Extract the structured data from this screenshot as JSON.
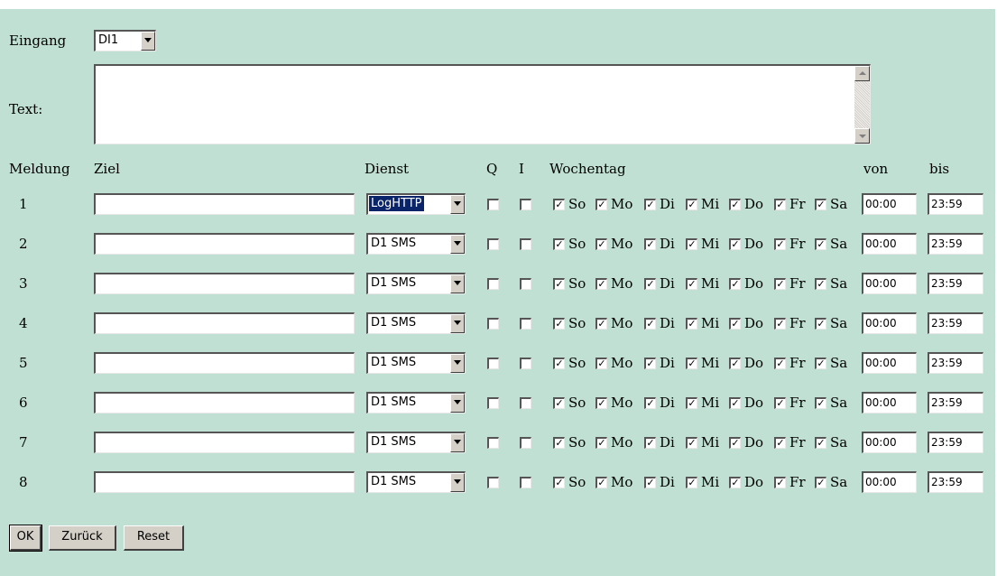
{
  "form": {
    "eingang_label": "Eingang",
    "eingang_value": "DI1",
    "text_label": "Text:",
    "text_value": ""
  },
  "columns": {
    "meldung": "Meldung",
    "ziel": "Ziel",
    "dienst": "Dienst",
    "q": "Q",
    "i": "I",
    "wochentag": "Wochentag",
    "von": "von",
    "bis": "bis"
  },
  "weekdays": [
    "So",
    "Mo",
    "Di",
    "Mi",
    "Do",
    "Fr",
    "Sa"
  ],
  "rows": [
    {
      "nr": "1",
      "ziel": "",
      "dienst": "LogHTTP",
      "q": false,
      "i": false,
      "days": [
        true,
        true,
        true,
        true,
        true,
        true,
        true
      ],
      "von": "00:00",
      "bis": "23:59"
    },
    {
      "nr": "2",
      "ziel": "",
      "dienst": "D1 SMS",
      "q": false,
      "i": false,
      "days": [
        true,
        true,
        true,
        true,
        true,
        true,
        true
      ],
      "von": "00:00",
      "bis": "23:59"
    },
    {
      "nr": "3",
      "ziel": "",
      "dienst": "D1 SMS",
      "q": false,
      "i": false,
      "days": [
        true,
        true,
        true,
        true,
        true,
        true,
        true
      ],
      "von": "00:00",
      "bis": "23:59"
    },
    {
      "nr": "4",
      "ziel": "",
      "dienst": "D1 SMS",
      "q": false,
      "i": false,
      "days": [
        true,
        true,
        true,
        true,
        true,
        true,
        true
      ],
      "von": "00:00",
      "bis": "23:59"
    },
    {
      "nr": "5",
      "ziel": "",
      "dienst": "D1 SMS",
      "q": false,
      "i": false,
      "days": [
        true,
        true,
        true,
        true,
        true,
        true,
        true
      ],
      "von": "00:00",
      "bis": "23:59"
    },
    {
      "nr": "6",
      "ziel": "",
      "dienst": "D1 SMS",
      "q": false,
      "i": false,
      "days": [
        true,
        true,
        true,
        true,
        true,
        true,
        true
      ],
      "von": "00:00",
      "bis": "23:59"
    },
    {
      "nr": "7",
      "ziel": "",
      "dienst": "D1 SMS",
      "q": false,
      "i": false,
      "days": [
        true,
        true,
        true,
        true,
        true,
        true,
        true
      ],
      "von": "00:00",
      "bis": "23:59"
    },
    {
      "nr": "8",
      "ziel": "",
      "dienst": "D1 SMS",
      "q": false,
      "i": false,
      "days": [
        true,
        true,
        true,
        true,
        true,
        true,
        true
      ],
      "von": "00:00",
      "bis": "23:59"
    }
  ],
  "buttons": {
    "ok": "OK",
    "back": "Zurück",
    "reset": "Reset"
  },
  "colors": {
    "panel_bg": "#bfe0d3",
    "selection_bg": "#0a246a"
  }
}
